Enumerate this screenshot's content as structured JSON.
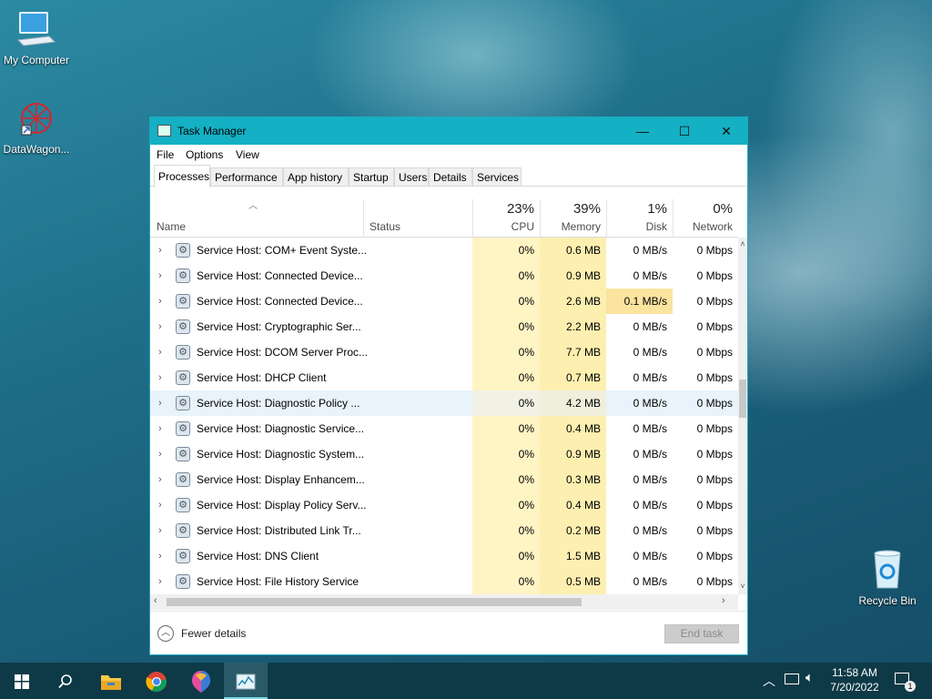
{
  "desktop": {
    "icons": [
      {
        "label": "My Computer"
      },
      {
        "label": "DataWagon..."
      },
      {
        "label": "Recycle Bin"
      }
    ]
  },
  "window": {
    "title": "Task Manager",
    "controls": {
      "minimize": "—",
      "maximize": "☐",
      "close": "✕"
    },
    "menu": [
      "File",
      "Options",
      "View"
    ],
    "tabs": [
      "Processes",
      "Performance",
      "App history",
      "Startup",
      "Users",
      "Details",
      "Services"
    ],
    "active_tab": "Processes",
    "columns": {
      "name": "Name",
      "status": "Status",
      "cpu": {
        "pct": "23%",
        "label": "CPU"
      },
      "memory": {
        "pct": "39%",
        "label": "Memory"
      },
      "disk": {
        "pct": "1%",
        "label": "Disk"
      },
      "network": {
        "pct": "0%",
        "label": "Network"
      }
    },
    "processes": [
      {
        "name": "Service Host: COM+ Event Syste...",
        "cpu": "0%",
        "memory": "0.6 MB",
        "disk": "0 MB/s",
        "network": "0 Mbps"
      },
      {
        "name": "Service Host: Connected Device...",
        "cpu": "0%",
        "memory": "0.9 MB",
        "disk": "0 MB/s",
        "network": "0 Mbps"
      },
      {
        "name": "Service Host: Connected Device...",
        "cpu": "0%",
        "memory": "2.6 MB",
        "disk": "0.1 MB/s",
        "network": "0 Mbps"
      },
      {
        "name": "Service Host: Cryptographic Ser...",
        "cpu": "0%",
        "memory": "2.2 MB",
        "disk": "0 MB/s",
        "network": "0 Mbps"
      },
      {
        "name": "Service Host: DCOM Server Proc...",
        "cpu": "0%",
        "memory": "7.7 MB",
        "disk": "0 MB/s",
        "network": "0 Mbps"
      },
      {
        "name": "Service Host: DHCP Client",
        "cpu": "0%",
        "memory": "0.7 MB",
        "disk": "0 MB/s",
        "network": "0 Mbps"
      },
      {
        "name": "Service Host: Diagnostic Policy ...",
        "cpu": "0%",
        "memory": "4.2 MB",
        "disk": "0 MB/s",
        "network": "0 Mbps"
      },
      {
        "name": "Service Host: Diagnostic Service...",
        "cpu": "0%",
        "memory": "0.4 MB",
        "disk": "0 MB/s",
        "network": "0 Mbps"
      },
      {
        "name": "Service Host: Diagnostic System...",
        "cpu": "0%",
        "memory": "0.9 MB",
        "disk": "0 MB/s",
        "network": "0 Mbps"
      },
      {
        "name": "Service Host: Display Enhancem...",
        "cpu": "0%",
        "memory": "0.3 MB",
        "disk": "0 MB/s",
        "network": "0 Mbps"
      },
      {
        "name": "Service Host: Display Policy Serv...",
        "cpu": "0%",
        "memory": "0.4 MB",
        "disk": "0 MB/s",
        "network": "0 Mbps"
      },
      {
        "name": "Service Host: Distributed Link Tr...",
        "cpu": "0%",
        "memory": "0.2 MB",
        "disk": "0 MB/s",
        "network": "0 Mbps"
      },
      {
        "name": "Service Host: DNS Client",
        "cpu": "0%",
        "memory": "1.5 MB",
        "disk": "0 MB/s",
        "network": "0 Mbps"
      },
      {
        "name": "Service Host: File History Service",
        "cpu": "0%",
        "memory": "0.5 MB",
        "disk": "0 MB/s",
        "network": "0 Mbps"
      }
    ],
    "selected_row": 6,
    "footer": {
      "fewer_details": "Fewer details",
      "end_task": "End task"
    }
  },
  "taskbar": {
    "clock_time": "11:58 AM",
    "clock_date": "7/20/2022",
    "notification_count": "1"
  },
  "colors": {
    "titlebar": "#14b0c4",
    "cpu_col": "#fff4c4",
    "mem_col": "#fdefb0",
    "disk_highlight": "#fbe3a0",
    "taskbar": "#0e3a47"
  }
}
